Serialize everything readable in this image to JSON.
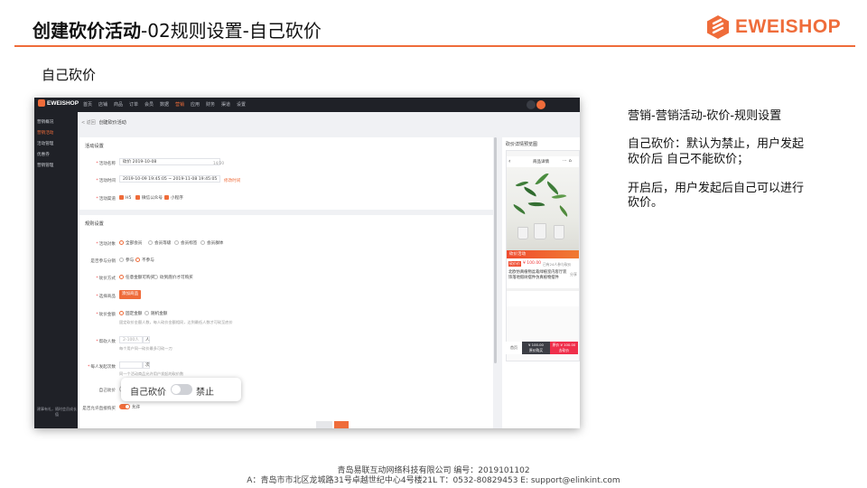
{
  "slide": {
    "title_bold": "创建砍价活动",
    "title_rest": "-02规则设置-自己砍价",
    "subtitle": "自己砍价",
    "logo_text": "EWEISHOP",
    "accent_color": "#ef6c3a"
  },
  "app": {
    "brand": "EWEISHOP",
    "nav": [
      "首页",
      "店铺",
      "商品",
      "订单",
      "会员",
      "数据",
      "营销",
      "应用",
      "财务",
      "渠道",
      "设置"
    ],
    "active_nav": "营销",
    "sidebar": [
      "营销概况",
      "营销活动",
      "活动管理",
      "优惠券",
      "营销管理"
    ],
    "active_sidebar": "营销活动",
    "sidebar_footer": "建事有礼，随时会员成长值",
    "breadcrumb_back": "< 返回",
    "breadcrumb_current": "创建砍价活动",
    "activity_section": {
      "title": "活动设置",
      "name_label": "活动名称",
      "name_value": "砍价 2019-10-08",
      "name_counter": "14/20",
      "time_label": "活动时间",
      "time_value": "2019-10-09 19:45:05 ~ 2019-11-08 19:45:05",
      "time_link": "修改时间",
      "channel_label": "活动渠道",
      "channels": [
        "H5",
        "微信公众号",
        "小程序"
      ]
    },
    "rules_section": {
      "title": "规则设置",
      "join_label": "活动对象",
      "join_options": [
        "全部会员",
        "会员等级",
        "会员标签",
        "会员群体"
      ],
      "share_label": "是否参与分销",
      "share_options": [
        "参与",
        "不参与"
      ],
      "method_label": "砍价方式",
      "method_options": [
        "任意金额可购买",
        "砍到底价才可购买"
      ],
      "goods_label": "选择商品",
      "goods_button": "添加商品",
      "amount_label": "砍价金额",
      "amount_options": [
        "固定金额",
        "随机金额"
      ],
      "amount_hint": "固定砍价金额人数，每人砍价金额相同，达到最低人数才可砍至底价",
      "people_label": "帮砍人数",
      "people_placeholder": "2-100人",
      "people_unit": "人",
      "people_hint": "每个用户同一砍价最多可砍一刀",
      "limit_label": "每人发起次数",
      "limit_unit": "次",
      "limit_hint": "同一个活动商品允许用户发起的砍价数",
      "self_label": "自己砍价",
      "direct_label": "是否允许直接购买",
      "direct_state": "允许"
    },
    "preview": {
      "title": "砍价详情预览图",
      "shop_name": "商品详情",
      "banner": "砍价活动",
      "price_tag": "砍价价",
      "price": "¥ 100.00",
      "sold": "已有24人参与砍价",
      "product_desc": "北欧仿真植物盆栽绿植室内客厅装饰落地假树摆件仿真植物摆件",
      "share": "分享",
      "btn_home": "首页",
      "btn_buy_price": "¥ 100.00",
      "btn_buy": "原价购买",
      "btn_bargain_price": "原价 ¥ 100.00",
      "btn_bargain": "去砍价"
    }
  },
  "popup": {
    "label": "自己砍价",
    "state": "禁止"
  },
  "explanation": {
    "heading": "营销-营销活动-砍价-规则设置",
    "p1_l1": "自己砍价：默认为禁止，用户发起",
    "p1_l2": "砍价后 自己不能砍价；",
    "p2_l1": "开启后，用户发起后自己可以进行",
    "p2_l2": "砍价。"
  },
  "footer": {
    "line1": "青岛易联互动网络科技有限公司    编号：2019101102",
    "line2": "A：青岛市市北区龙城路31号卓越世纪中心4号楼21L    T：0532-80829453    E: support@elinkint.com"
  }
}
